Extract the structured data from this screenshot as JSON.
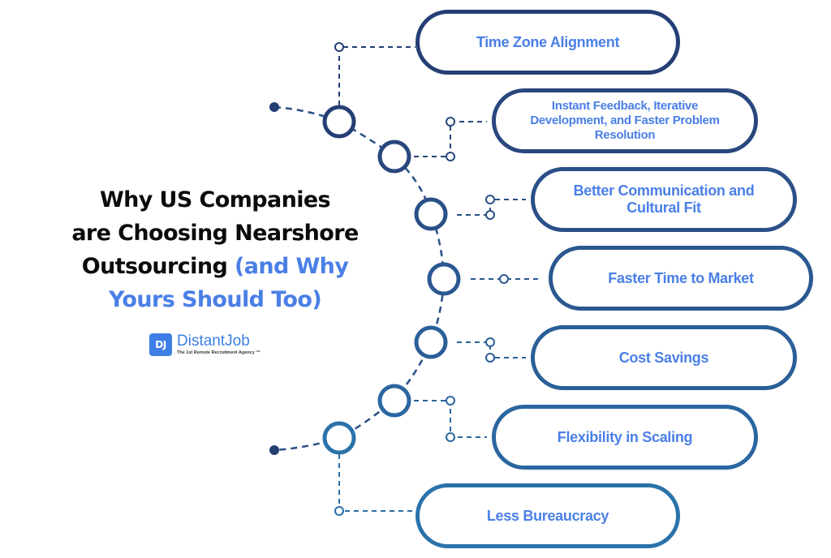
{
  "title": {
    "line1": "Why US Companies",
    "line2": "are Choosing Nearshore",
    "line3_black": "Outsourcing ",
    "line3_blue": "(and Why",
    "line4_blue": "Yours Should Too)"
  },
  "logo": {
    "badge": "DJ",
    "name": "DistantJob",
    "tagline": "The 1st Remote Recruitment Agency ™"
  },
  "colors": {
    "accent_text": "#4a7fe6",
    "navy": "#253f75",
    "steel_blue": "#2a72aa",
    "title_black": "#0b0b0b"
  },
  "items": [
    {
      "label": "Time Zone Alignment"
    },
    {
      "label": "Instant Feedback, Iterative Development, and Faster Problem Resolution"
    },
    {
      "label": "Better Communication and Cultural Fit"
    },
    {
      "label": "Faster Time to Market"
    },
    {
      "label": "Cost Savings"
    },
    {
      "label": "Flexibility in Scaling"
    },
    {
      "label": "Less Bureaucracy"
    }
  ]
}
